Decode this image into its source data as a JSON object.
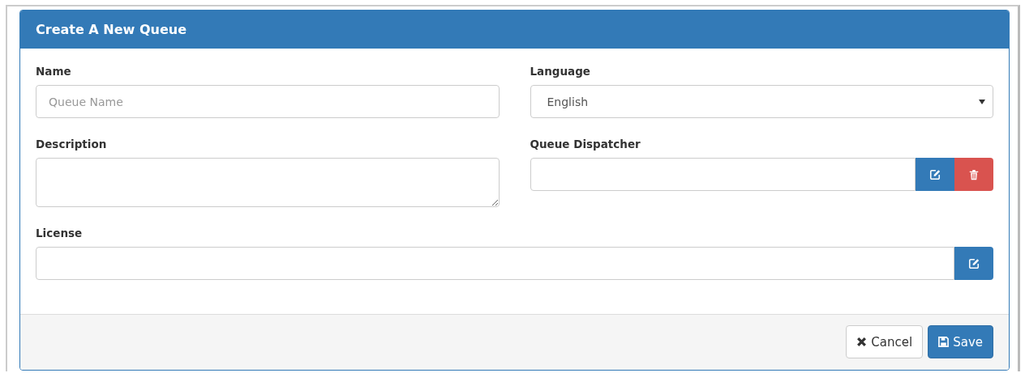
{
  "panel": {
    "title": "Create A New Queue"
  },
  "fields": [
    {
      "kind": "text",
      "label": "Name",
      "placeholder": "Queue Name",
      "full_width": false
    },
    {
      "kind": "select",
      "label": "Language",
      "value": "English",
      "full_width": false
    },
    {
      "kind": "textarea",
      "label": "Description",
      "full_width": false
    },
    {
      "kind": "picker",
      "label": "Queue Dispatcher",
      "full_width": false,
      "buttons": [
        {
          "kind": "edit"
        },
        {
          "kind": "delete"
        }
      ]
    },
    {
      "kind": "picker",
      "label": "License",
      "full_width": true,
      "buttons": [
        {
          "kind": "edit"
        }
      ]
    }
  ],
  "footer": {
    "buttons": [
      {
        "kind": "cancel",
        "label": "Cancel"
      },
      {
        "kind": "save",
        "label": "Save"
      }
    ]
  }
}
